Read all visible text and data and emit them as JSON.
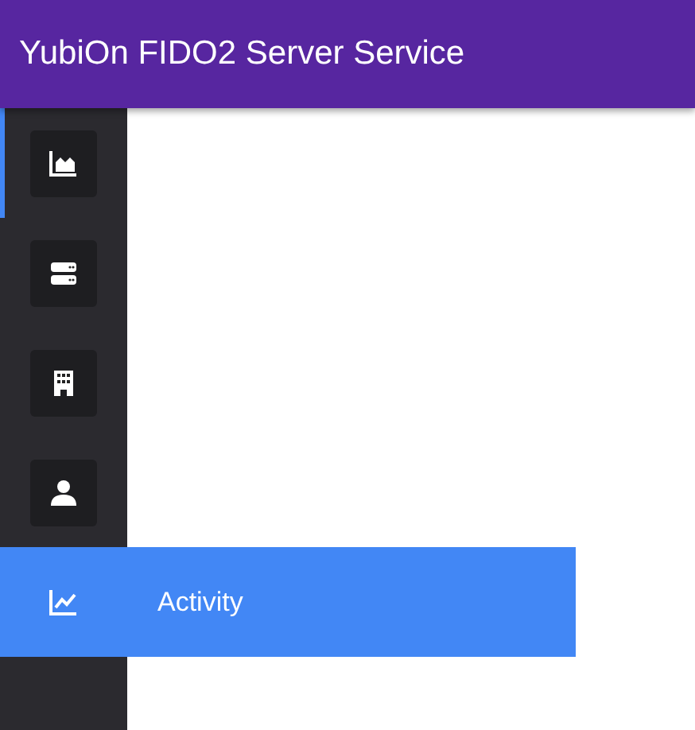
{
  "header": {
    "title": "YubiOn FIDO2 Server Service"
  },
  "nav": {
    "items": [
      {
        "selected": true,
        "expanded": false
      },
      {
        "selected": false,
        "expanded": false
      },
      {
        "selected": false,
        "expanded": false
      },
      {
        "selected": false,
        "expanded": false
      },
      {
        "selected": false,
        "expanded": true,
        "label": "Activity"
      }
    ]
  }
}
